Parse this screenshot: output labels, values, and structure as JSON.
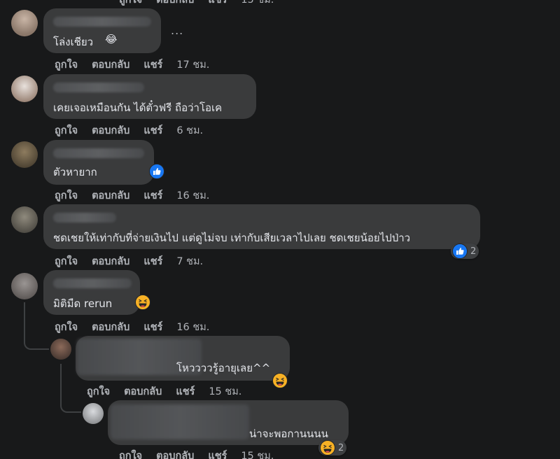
{
  "actions": {
    "like": "ถูกใจ",
    "reply": "ตอบกลับ",
    "share": "แชร์"
  },
  "more_label": "...",
  "comments": [
    {
      "text": "โล่งเชียว",
      "time": "17 ชม.",
      "emoji": "😂"
    },
    {
      "text": "เคยเจอเหมือนกัน ได้ตั๋วฟรี ถือว่าโอเค",
      "time": "6 ชม."
    },
    {
      "text": "ตัวหายาก",
      "time": "16 ชม.",
      "reaction": "like"
    },
    {
      "text": "ชดเชยให้เท่ากับที่จ่ายเงินไป แต่ดูไม่จบ เท่ากับเสียเวลาไปเลย ชดเชยน้อยไปป่าว",
      "time": "7 ชม.",
      "reaction": "like",
      "reaction_count": "2"
    },
    {
      "text": "มิติมืด rerun",
      "time": "16 ชม.",
      "reaction": "haha"
    },
    {
      "text": "โหววววรู้อายุเลย^^",
      "time": "15 ชม.",
      "reaction": "haha"
    },
    {
      "text": "น่าจะพอกานนนน",
      "time": "15 ชม.",
      "reaction": "haha",
      "reaction_count": "2"
    }
  ],
  "top_partial": {
    "time": "15 ชม."
  },
  "colors": {
    "background": "#18191a",
    "bubble": "#3a3b3c",
    "muted_text": "#b0b3b8",
    "like_blue": "#1877f2",
    "haha_yellow": "#f7b125"
  }
}
